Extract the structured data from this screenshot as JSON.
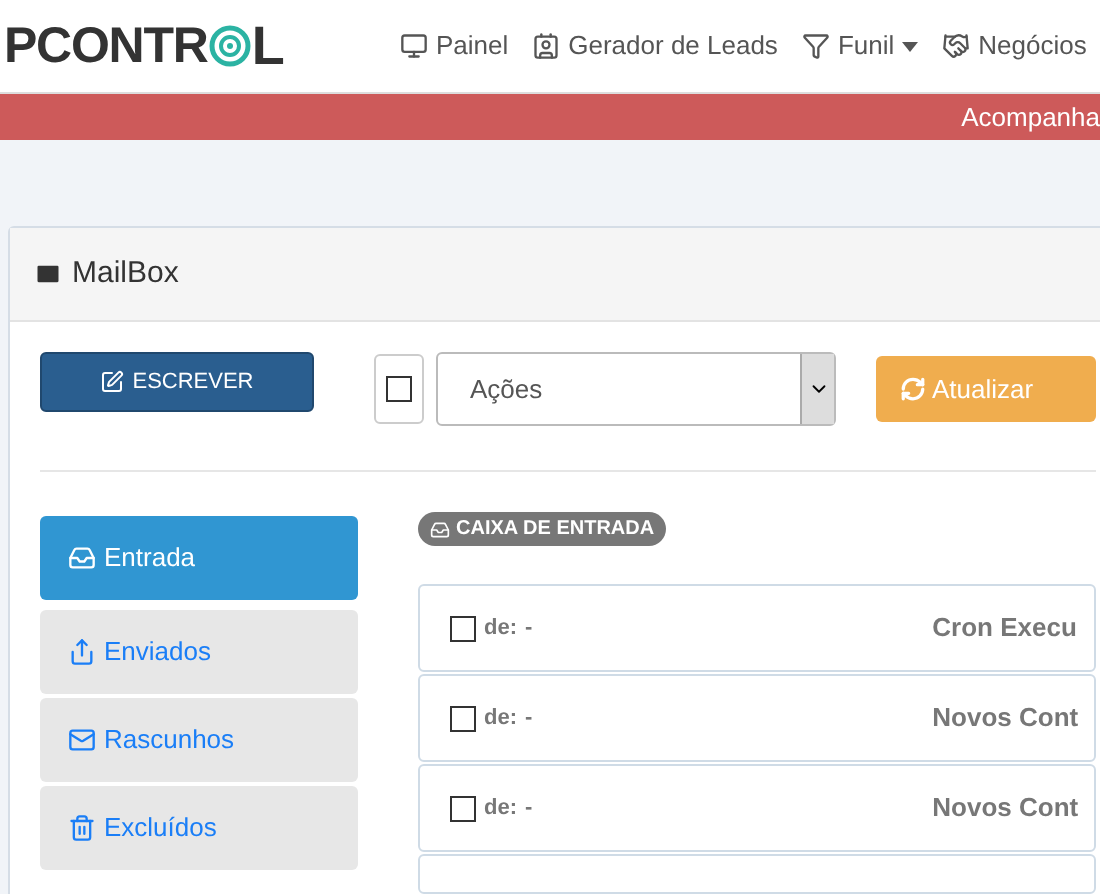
{
  "logo": {
    "text_start": "PCONTR",
    "text_end": "L"
  },
  "nav": [
    {
      "kind": "monitor",
      "label": "Painel"
    },
    {
      "kind": "contact",
      "label": "Gerador de Leads"
    },
    {
      "kind": "filter",
      "label": "Funil",
      "dropdown": true
    },
    {
      "kind": "handshake",
      "label": "Negócios",
      "dropdown": false
    }
  ],
  "banner": "Acompanha",
  "panel": {
    "title": "MailBox"
  },
  "compose_button": "ESCREVER",
  "select_all": {
    "checked": false
  },
  "actions": {
    "value": "Ações"
  },
  "refresh_button": "Atualizar",
  "folders": [
    {
      "kind": "inbox",
      "label": "Entrada",
      "selected": true
    },
    {
      "kind": "sent",
      "label": "Enviados",
      "selected": false
    },
    {
      "kind": "drafts",
      "label": "Rascunhos",
      "selected": false
    },
    {
      "kind": "trash",
      "label": "Excluídos",
      "selected": false
    }
  ],
  "folder_badge": "CAIXA DE ENTRADA",
  "messages": [
    {
      "checked": false,
      "from_label": "de:",
      "from": "-",
      "subject": "Cron Execu"
    },
    {
      "checked": false,
      "from_label": "de:",
      "from": "-",
      "subject": "Novos Cont"
    },
    {
      "checked": false,
      "from_label": "de:",
      "from": "-",
      "subject": "Novos Cont"
    }
  ]
}
